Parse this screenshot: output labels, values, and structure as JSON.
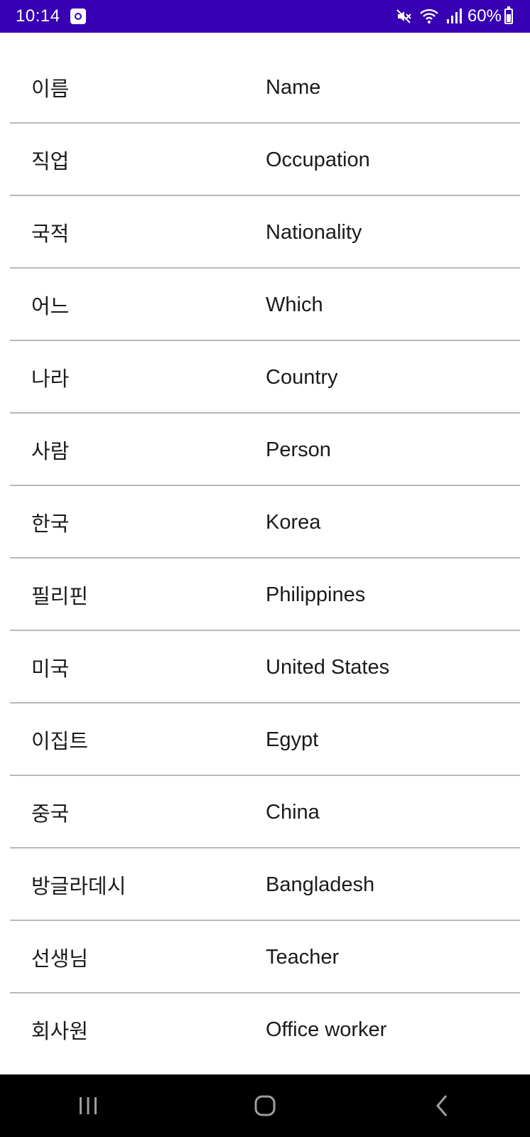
{
  "status_bar": {
    "time": "10:14",
    "battery": "60%",
    "icons": [
      "app-notification-icon",
      "mute-icon",
      "wifi-icon",
      "signal-icon",
      "battery-icon"
    ]
  },
  "vocab": [
    {
      "korean": "이름",
      "english": "Name"
    },
    {
      "korean": "직업",
      "english": "Occupation"
    },
    {
      "korean": "국적",
      "english": "Nationality"
    },
    {
      "korean": "어느",
      "english": "Which"
    },
    {
      "korean": "나라",
      "english": "Country"
    },
    {
      "korean": "사람",
      "english": "Person"
    },
    {
      "korean": "한국",
      "english": "Korea"
    },
    {
      "korean": "필리핀",
      "english": "Philippines"
    },
    {
      "korean": "미국",
      "english": "United States"
    },
    {
      "korean": "이집트",
      "english": "Egypt"
    },
    {
      "korean": "중국",
      "english": "China"
    },
    {
      "korean": "방글라데시",
      "english": "Bangladesh"
    },
    {
      "korean": "선생님",
      "english": "Teacher"
    },
    {
      "korean": "회사원",
      "english": "Office worker"
    }
  ],
  "nav_bar": {
    "icons": [
      "recent-apps-icon",
      "home-icon",
      "back-icon"
    ]
  },
  "colors": {
    "status_bar": "#3700b3",
    "divider": "#b9b9b9",
    "nav_bar": "#000000"
  }
}
